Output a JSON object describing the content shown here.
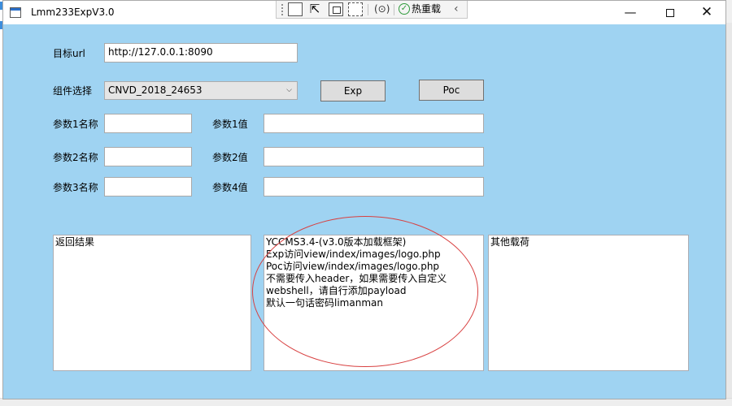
{
  "window": {
    "title": "Lmm233ExpV3.0",
    "controls": {
      "minimize": "—",
      "maximize": "",
      "close": "✕"
    }
  },
  "debug_toolbar": {
    "hot_reload_label": "热重载",
    "collapse": "‹"
  },
  "form": {
    "target_url_label": "目标url",
    "target_url_value": "http://127.0.0.1:8090",
    "component_label": "组件选择",
    "component_selected": "CNVD_2018_24653",
    "exp_button": "Exp",
    "poc_button": "Poc",
    "params": [
      {
        "name_label": "参数1名称",
        "name_value": "",
        "value_label": "参数1值",
        "value_value": ""
      },
      {
        "name_label": "参数2名称",
        "name_value": "",
        "value_label": "参数2值",
        "value_value": ""
      },
      {
        "name_label": "参数3名称",
        "name_value": "",
        "value_label": "参数4值",
        "value_value": ""
      }
    ]
  },
  "outputs": {
    "result_text": "返回结果",
    "info_lines": [
      "YCCMS3.4-(v3.0版本加载框架)",
      "Exp访问view/index/images/logo.php",
      "Poc访问view/index/images/logo.php",
      "不需要传入header，如果需要传入自定义",
      "webshell，请自行添加payload",
      "默认一句话密码limanman"
    ],
    "payload_text": "其他载荷"
  },
  "colors": {
    "client_bg": "#9fd3f2",
    "annotation": "#d84040",
    "hot_reload_check": "#2e9a3a"
  }
}
